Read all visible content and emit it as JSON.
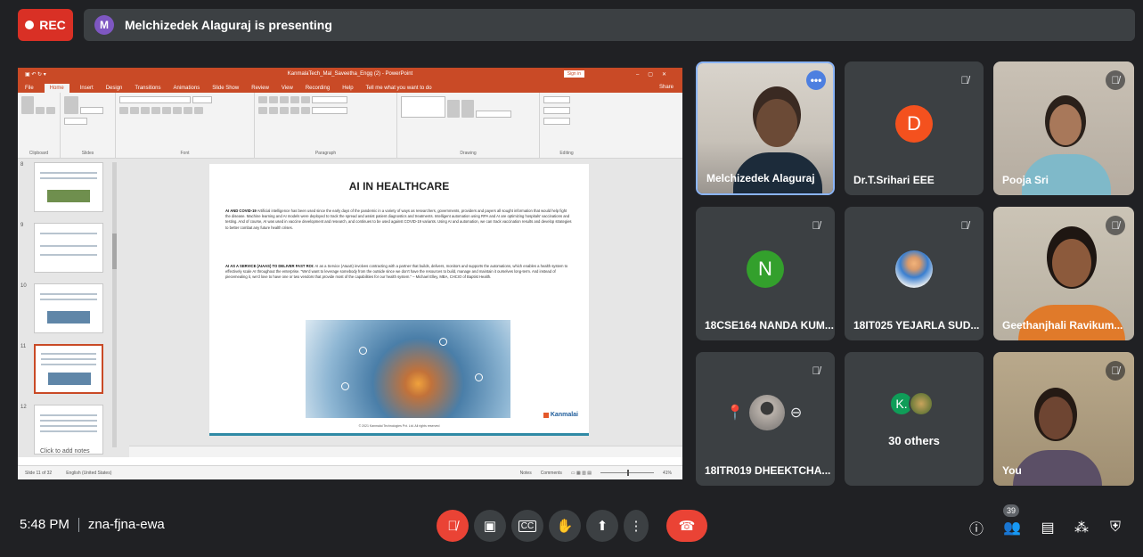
{
  "top": {
    "rec_label": "REC",
    "presenter_initial": "M",
    "presenting_text": "Melchizedek Alaguraj is presenting"
  },
  "ppt": {
    "title": "KanmalaTech_Mal_Saveetha_Engg (2) - PowerPoint",
    "signin": "Sign in",
    "tabs": [
      "File",
      "Home",
      "Insert",
      "Design",
      "Transitions",
      "Animations",
      "Slide Show",
      "Review",
      "View",
      "Recording",
      "Help",
      "Tell me what you want to do"
    ],
    "share": "Share",
    "groups": [
      "Clipboard",
      "Slides",
      "Font",
      "Paragraph",
      "Drawing",
      "Editing"
    ],
    "slide_numbers": [
      "8",
      "9",
      "10",
      "11",
      "12"
    ],
    "slide": {
      "title": "AI IN HEALTHCARE",
      "p1_lead": "AI AND COVID-19",
      "p1": "Artificial intelligence has been used since the early days of the pandemic in a variety of ways as researchers, governments, providers and payers all sought information that would help fight the disease. Machine learning and AI models were deployed to track the spread and assist patient diagnostics and treatments. Intelligent automation using RPA and AI are optimizing hospitals' vaccinations and testing. And of course, AI was used in vaccine development and research, and continues to be used against COVID-19 variants. Using AI and automation, we can track vaccination results and develop strategies to better combat any future health crises.",
      "p2_lead": "AI AS A SERVICE (AIAAS) TO DELIVER FAST ROI:",
      "p2": "AI as a Service (AIaaS) involves contracting with a partner that builds, delivers, monitors and supports the automations, which enables a health system to effectively scale AI throughout the enterprise. \"We'd want to leverage somebody from the outside since we don't have the resources to build, manage and maintain it ourselves long-term. And instead of piecemealing it, we'd love to have one or two vendors that provide most of the capabilities for our health system.\" – Michael Elley, MBA, CHCIO of Baptist Health.",
      "logo": "Kanmalai",
      "copyright": "© 2021 Kanmalai Technologies Pvt. Ltd. All rights reserved"
    },
    "notes_placeholder": "Click to add notes",
    "status_left": "Slide 11 of 32",
    "status_lang": "English (United States)",
    "status_notes": "Notes",
    "status_comments": "Comments",
    "zoom": "41%"
  },
  "tiles": [
    {
      "name": "Melchizedek Alaguraj"
    },
    {
      "name": "Dr.T.Srihari EEE",
      "initial": "D",
      "color": "#f4511e"
    },
    {
      "name": "Pooja Sri"
    },
    {
      "name": "18CSE164 NANDA KUM...",
      "initial": "N",
      "color": "#33a02c"
    },
    {
      "name": "18IT025 YEJARLA SUD..."
    },
    {
      "name": "Geethanjhali Ravikum..."
    },
    {
      "name": "18ITR019 DHEEKTCHA..."
    },
    {
      "name": "30 others",
      "initial": "K."
    },
    {
      "name": "You"
    }
  ],
  "bottom": {
    "time": "5:48 PM",
    "meeting_code": "zna-fjna-ewa",
    "participants_count": "39"
  }
}
